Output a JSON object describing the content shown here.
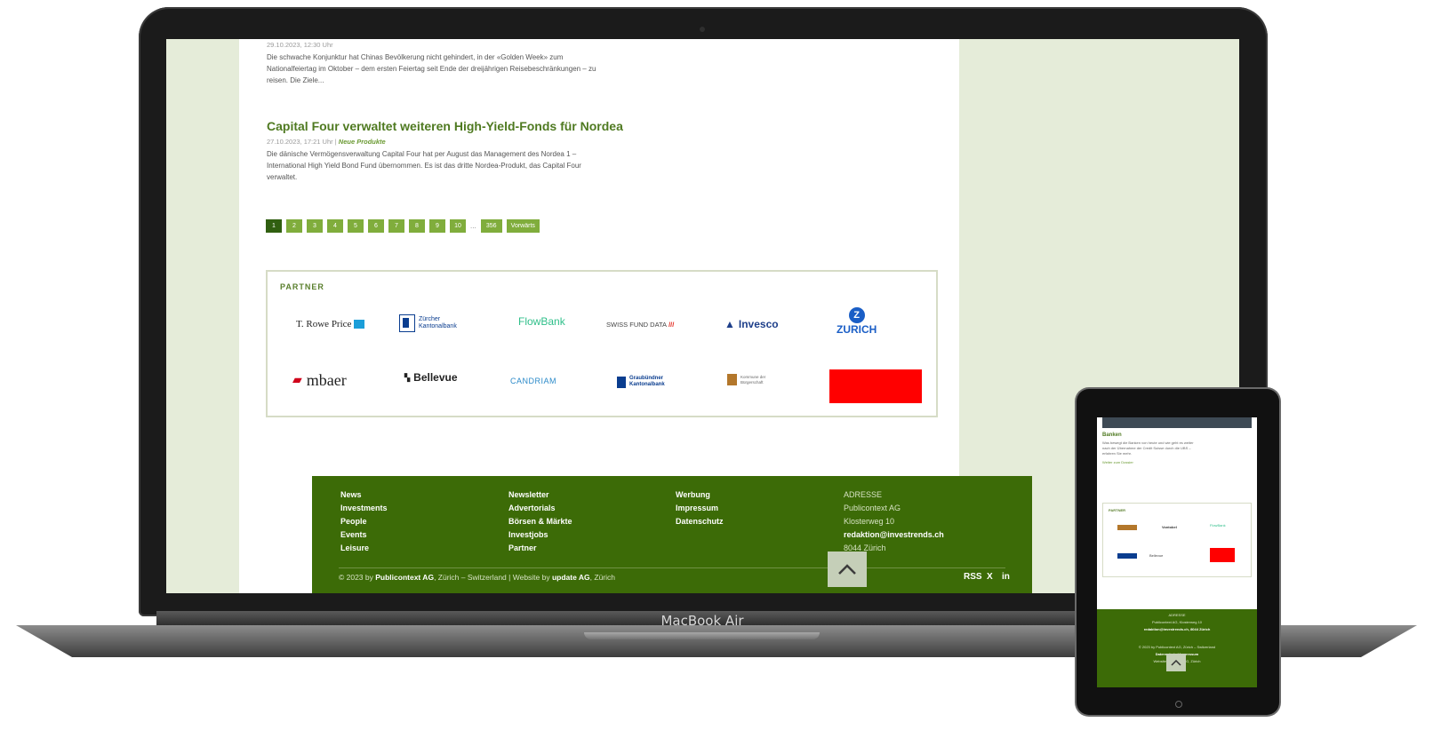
{
  "device": {
    "laptop_label": "MacBook Air"
  },
  "articles": [
    {
      "date": "29.10.2023, 12:30 Uhr",
      "excerpt_l1": "Die schwache Konjunktur hat Chinas Bevölkerung nicht gehindert, in der «Golden Week» zum",
      "excerpt_l2": "Nationalfeiertag im Oktober – dem ersten Feiertag seit Ende der dreijährigen Reisebeschränkungen – zu",
      "excerpt_l3": "reisen. Die Ziele..."
    },
    {
      "title": "Capital Four verwaltet weiteren High-Yield-Fonds für Nordea",
      "date": "27.10.2023, 17:21 Uhr",
      "separator": "|",
      "category": "Neue Produkte",
      "excerpt_l1": "Die dänische Vermögensverwaltung Capital Four hat per August das Management des Nordea 1 –",
      "excerpt_l2": "International High Yield Bond Fund übernommen. Es ist das dritte Nordea-Produkt, das Capital Four",
      "excerpt_l3": "verwaltet."
    }
  ],
  "pagination": {
    "pages": [
      "1",
      "2",
      "3",
      "4",
      "5",
      "6",
      "7",
      "8",
      "9",
      "10"
    ],
    "ellipsis": "...",
    "last": "356",
    "next": "Vorwärts",
    "current": "1"
  },
  "partners": {
    "title": "PARTNER",
    "row1": [
      "T. Rowe Price",
      "Zürcher Kantonalbank",
      "FlowBank",
      "SWISS FUND DATA",
      "Invesco",
      "ZURICH"
    ],
    "row2": [
      "mbaer",
      "Bellevue",
      "CANDRIAM",
      "Graubündner Kantonalbank",
      "Kommune der Bürgerschaft",
      ""
    ]
  },
  "footer": {
    "col1": [
      "News",
      "Investments",
      "People",
      "Events",
      "Leisure"
    ],
    "col2": [
      "Newsletter",
      "Advertorials",
      "Börsen & Märkte",
      "Investjobs",
      "Partner"
    ],
    "col3": [
      "Werbung",
      "Impressum",
      "Datenschutz"
    ],
    "address": [
      "ADRESSE",
      "Publicontext AG",
      "Klosterweg 10",
      "redaktion@investrends.ch",
      "8044 Zürich"
    ],
    "copyright_prefix": "© 2023 by",
    "copyright_company": "Publicontext AG",
    "copyright_mid": ", Zürich – Switzerland | Website by",
    "copyright_agency": "update AG",
    "copyright_suffix": ", Zürich",
    "social": [
      "RSS",
      "X",
      "in"
    ]
  },
  "tablet": {
    "heading": "Banken",
    "text_l1": "Was bewegt die Banken von heute und wie geht es weiter",
    "text_l2": "nach der Übernahme der Credit Suisse durch die UBS –",
    "text_l3": "erfahren Sie mehr.",
    "link": "Weiter zum Dossier",
    "partner_title": "PARTNER",
    "logos_r1": [
      "",
      "Vontobel",
      "FlowBank"
    ],
    "logos_r2": [
      "",
      "Bellevue"
    ],
    "footer_l1": "ADRESSE",
    "footer_l2": "Publicontext AG, Klosterweg 10",
    "footer_l3": "redaktion@investrends.ch, 8044 Zürich",
    "footer_l4": "© 2023 by Publicontext AG, Zürich – Switzerland",
    "footer_l5": "Datenschutz | Impressum",
    "footer_l6": "Website by update AG, Zürich"
  },
  "colors": {
    "brand_green": "#3c6b07",
    "link_green": "#4f7a21",
    "accent_red": "#ff0000"
  }
}
